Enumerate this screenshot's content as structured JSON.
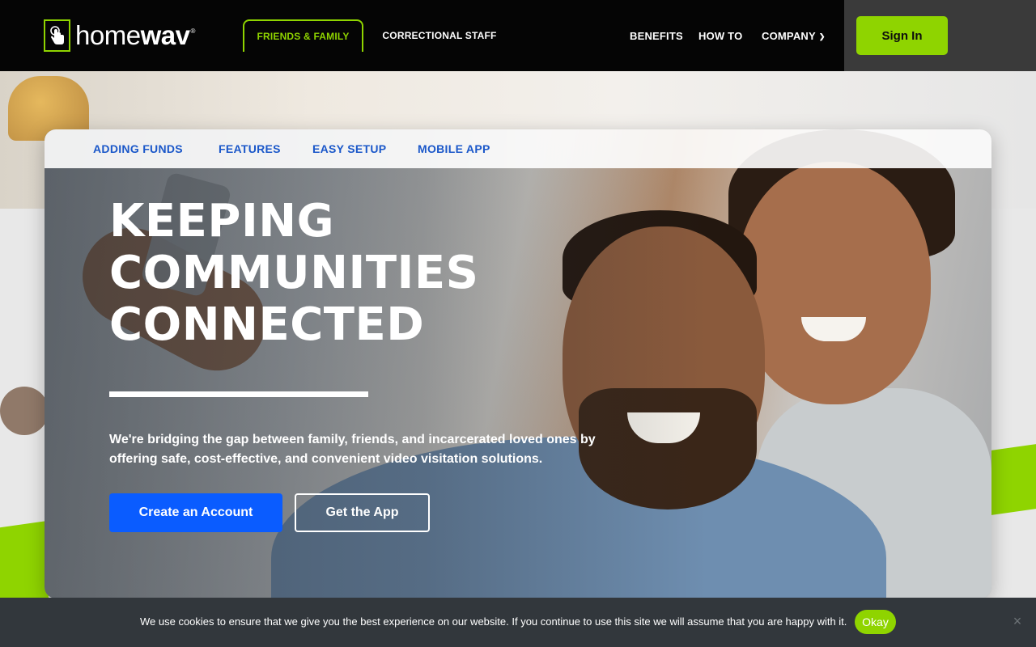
{
  "brand": {
    "name_light": "home",
    "name_bold": "wav",
    "registered": "®"
  },
  "audience_tabs": [
    {
      "label": "FRIENDS & FAMILY",
      "active": true
    },
    {
      "label": "CORRECTIONAL STAFF",
      "active": false
    }
  ],
  "nav": {
    "benefits": "BENEFITS",
    "how_to": "HOW TO",
    "company": "COMPANY",
    "sign_in": "Sign In"
  },
  "subnav": [
    "ADDING FUNDS",
    "FEATURES",
    "EASY SETUP",
    "MOBILE APP"
  ],
  "hero": {
    "headline_lines": [
      "KEEPING",
      "COMMUNITIES",
      "CONNECTED"
    ],
    "tagline": "We're bridging the gap between family, friends, and incarcerated loved ones by offering safe, cost-effective, and convenient video visitation solutions.",
    "primary_cta": "Create an Account",
    "secondary_cta": "Get the App"
  },
  "cookie": {
    "message": "We use cookies to ensure that we give you the best experience on our website. If you continue to use this site we will assume that you are happy with it.",
    "ok": "Okay",
    "close": "×"
  },
  "colors": {
    "brand_green": "#8fd400",
    "primary_blue": "#0a5cff",
    "link_blue": "#1a57c9",
    "nav_bg": "#050505"
  },
  "icons": {
    "logo": "hand-tap-icon",
    "company_dropdown": "chevron-down-icon",
    "cookie_close": "close-icon"
  }
}
